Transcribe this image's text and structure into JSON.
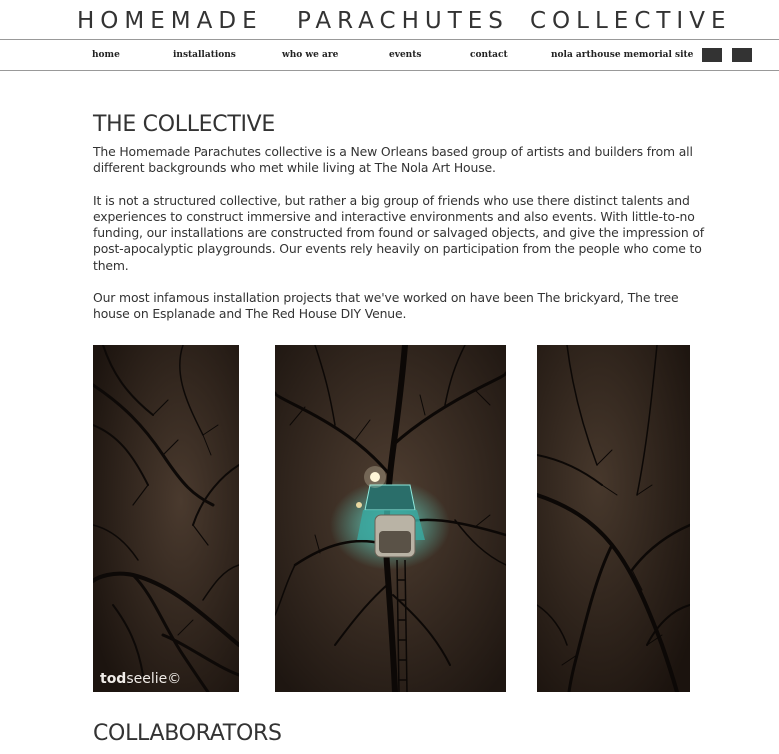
{
  "site": {
    "title_words": [
      "HOMEMADE",
      "PARACHUTES",
      "COLLECTIVE"
    ]
  },
  "nav": {
    "items": [
      {
        "label": "home"
      },
      {
        "label": "installations"
      },
      {
        "label": "who we are"
      },
      {
        "label": "events"
      },
      {
        "label": "contact"
      },
      {
        "label": "nola arthouse memorial site"
      }
    ]
  },
  "main": {
    "heading": "THE COLLECTIVE",
    "paragraphs": [
      "The Homemade Parachutes collective is a New Orleans based group of artists and builders from all different backgrounds who met while living at The Nola Art House.",
      "It is not a structured collective, but rather a big group of friends who use there distinct talents and experiences to construct immersive and interactive environments and also events. With little-to-no funding, our installations are constructed from found or salvaged objects, and give the impression of post-apocalyptic playgrounds. Our events rely heavily on participation from the people who come to them.",
      "Our most infamous installation projects that we've worked on have been The brickyard, The tree house on Esplanade and The Red House DIY Venue."
    ],
    "photo_watermark_bold": "tod",
    "photo_watermark_rest": "seelie©",
    "section2_heading": "COLLABORATORS"
  }
}
